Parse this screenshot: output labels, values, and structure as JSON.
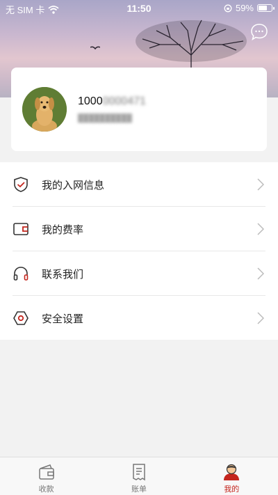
{
  "status_bar": {
    "carrier": "无 SIM 卡",
    "time": "11:50",
    "battery": "59%",
    "battery_level": 0.59
  },
  "header": {
    "chat_icon": "chat-bubble-icon"
  },
  "profile": {
    "phone_visible": "1000",
    "phone_masked": "0000471",
    "subtitle_masked": "██████████"
  },
  "menu": {
    "items": [
      {
        "label": "我的入网信息",
        "icon": "shield-check-icon"
      },
      {
        "label": "我的费率",
        "icon": "wallet-icon"
      },
      {
        "label": "联系我们",
        "icon": "headphones-icon"
      },
      {
        "label": "安全设置",
        "icon": "hex-settings-icon"
      }
    ]
  },
  "tabbar": {
    "tabs": [
      {
        "label": "收款",
        "icon": "wallet-receive-icon",
        "active": false
      },
      {
        "label": "账单",
        "icon": "bill-icon",
        "active": false
      },
      {
        "label": "我的",
        "icon": "user-icon",
        "active": true
      }
    ]
  },
  "colors": {
    "accent": "#c4251d",
    "tab_inactive": "#777777"
  }
}
